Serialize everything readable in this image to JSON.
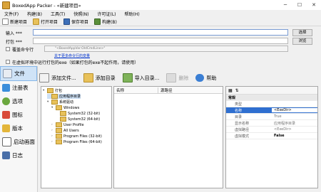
{
  "window": {
    "title": "BoxedApp Packer - «新建项目»"
  },
  "menu": [
    "文件(F)",
    "构建(B)",
    "工具(T)",
    "快照(N)",
    "许可证(L)",
    "帮助(H)"
  ],
  "toolbar": {
    "new": "新建项目",
    "open": "打开项目",
    "save": "保存项目",
    "build": "构建(B)"
  },
  "form": {
    "input_label": "输入 ***",
    "output_label": "打包 ***",
    "browse": "选择",
    "browse2": "浏览",
    "override_cmd_label": "覆盖命令行",
    "cmd_placeholder": "\"<BoxedAppVar:OldCmdLine>\"",
    "cmd_link": "关于更多命令行的变量",
    "virt_env_label": "在虚拟环境中运行打包的exe（如果打包的exe不起作用，请使用）"
  },
  "sidebar": [
    {
      "label": "文件",
      "icon": "files-icon",
      "active": true
    },
    {
      "label": "注册表",
      "icon": "registry-icon",
      "active": false
    },
    {
      "label": "选项",
      "icon": "options-icon",
      "active": false
    },
    {
      "label": "图标",
      "icon": "icons-icon",
      "active": false
    },
    {
      "label": "版本",
      "icon": "version-icon",
      "active": false
    },
    {
      "label": "启动画面",
      "icon": "splash-icon",
      "active": false
    },
    {
      "label": "日志",
      "icon": "log-icon",
      "active": false
    }
  ],
  "files_toolbar": {
    "add_file": "添加文件...",
    "add_dir": "添加目录",
    "import_dir": "导入目录...",
    "delete": "删除",
    "help": "帮助"
  },
  "tree": {
    "root": "打包",
    "items": [
      "应用程序目录",
      "系统驱动",
      "Windows",
      "System32 (32-bit)",
      "System32 (64-bit)",
      "User Profile",
      "All Users",
      "Program Files (32-bit)",
      "Program Files (64-bit)"
    ]
  },
  "list_headers": {
    "name": "名称",
    "path": "源路径"
  },
  "properties": {
    "section": "常规",
    "rows": [
      {
        "key": "类型",
        "value": ""
      },
      {
        "key": "名称",
        "value": "<ExeDir>"
      },
      {
        "key": "目录",
        "value": "True"
      },
      {
        "key": "显示名称",
        "value": "应用程序目录"
      },
      {
        "key": "虚拟路径",
        "value": "<ExeDir>"
      },
      {
        "key": "虚拟模式",
        "value": "False"
      }
    ]
  }
}
